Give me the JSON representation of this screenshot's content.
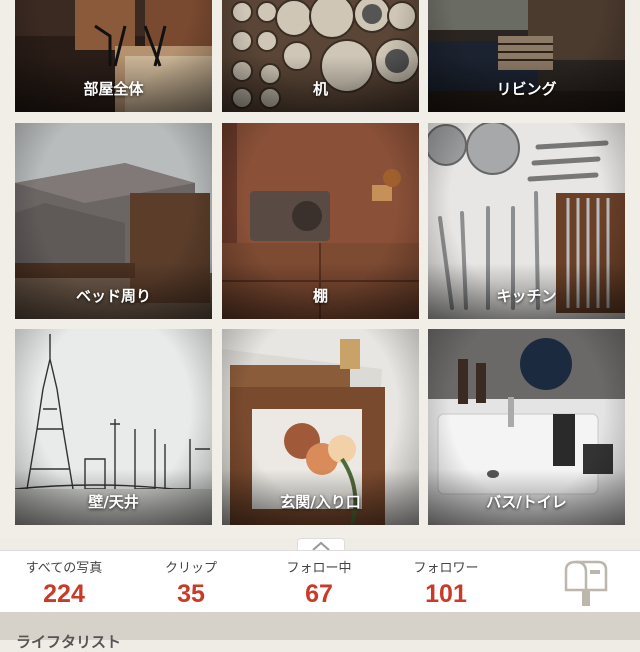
{
  "tiles": [
    {
      "label": "部屋全体",
      "icon": "room-photo"
    },
    {
      "label": "机",
      "icon": "desk-photo"
    },
    {
      "label": "リビング",
      "icon": "living-photo"
    },
    {
      "label": "ベッド周り",
      "icon": "bed-photo"
    },
    {
      "label": "棚",
      "icon": "shelf-photo"
    },
    {
      "label": "キッチン",
      "icon": "kitchen-photo"
    },
    {
      "label": "壁/天井",
      "icon": "wall-photo"
    },
    {
      "label": "玄関/入り口",
      "icon": "entrance-photo"
    },
    {
      "label": "バス/トイレ",
      "icon": "bath-photo"
    }
  ],
  "stats": [
    {
      "label": "すべての写真",
      "value": "224"
    },
    {
      "label": "クリップ",
      "value": "35"
    },
    {
      "label": "フォロー中",
      "value": "67"
    },
    {
      "label": "フォロワー",
      "value": "101"
    }
  ],
  "bottom": {
    "text": "ライフタリスト"
  },
  "colors": {
    "accent": "#c73b28",
    "background": "#efece6"
  }
}
